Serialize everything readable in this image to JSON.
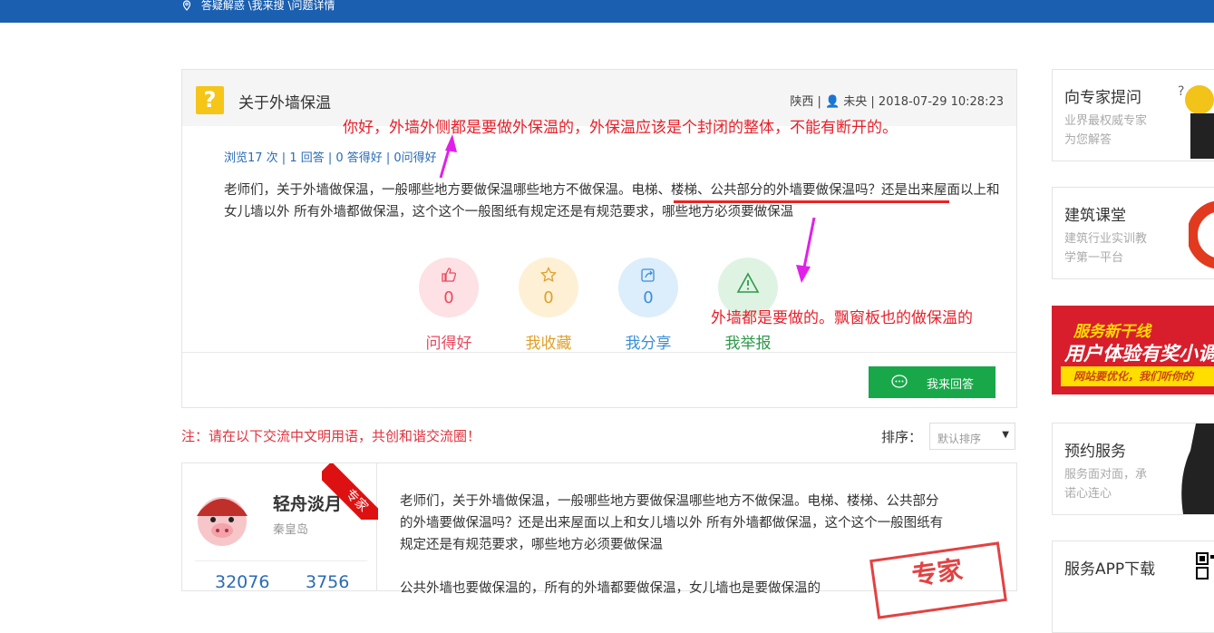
{
  "breadcrumb": "答疑解惑 \\我来搜 \\问题详情",
  "question": {
    "title": "关于外墙保温",
    "meta": "陕西 | 👤 未央 | 2018-07-29 10:28:23",
    "stats": "浏览17 次 | 1 回答 | 0 答得好 | 0问得好",
    "body": "老师们，关于外墙做保温，一般哪些地方要做保温哪些地方不做保温。电梯、楼梯、公共部分的外墙要做保温吗？还是出来屋面以上和女儿墙以外 所有外墙都做保温，这个这个一般图纸有规定还是有规范要求，哪些地方必须要做保温"
  },
  "actions": [
    {
      "label": "问得好",
      "count": "0",
      "color": "#e84a5f",
      "bg": "#fde1e4",
      "icon": "thumbs-up-icon"
    },
    {
      "label": "我收藏",
      "count": "0",
      "color": "#e0a02a",
      "bg": "#fdf0d5",
      "icon": "star-icon"
    },
    {
      "label": "我分享",
      "count": "0",
      "color": "#3a8fd8",
      "bg": "#dcedfb",
      "icon": "share-icon"
    },
    {
      "label": "我举报",
      "count": "",
      "color": "#2f9a4a",
      "bg": "#dff3e3",
      "icon": "warning-icon"
    }
  ],
  "answer_button": "我来回答",
  "note": "注：请在以下交流中文明用语，共创和谐交流圈！",
  "sort": {
    "label": "排序：",
    "selected": "默认排序"
  },
  "answer": {
    "username": "轻舟淡月",
    "city": "秦皇岛",
    "badge": "专家",
    "stat1": "32076",
    "stat2": "3756",
    "text": "老师们，关于外墙做保温，一般哪些地方要做保温哪些地方不做保温。电梯、楼梯、公共部分的外墙要做保温吗？还是出来屋面以上和女儿墙以外 所有外墙都做保温，这个这个一般图纸有规定还是有规范要求，哪些地方必须要做保温",
    "text2": "公共外墙也要做保温的，所有的外墙都要做保温，女儿墙也是要做保温的",
    "stamp": "专家"
  },
  "sidebar": [
    {
      "title": "向专家提问",
      "sub": "业界最权威专家为您解答"
    },
    {
      "title": "建筑课堂",
      "sub": "建筑行业实训教学第一平台"
    },
    {
      "title": "预约服务",
      "sub": "服务面对面，承诺心连心"
    },
    {
      "title": "服务APP下载",
      "sub": ""
    }
  ],
  "banner": {
    "line1": "服务新干线",
    "line2": "用户体验有奖小调",
    "line3": "网站要优化，我们听你的"
  },
  "annotations": {
    "a1": "你好，外墙外侧都是要做外保温的，外保温应该是个封闭的整体，不能有断开的。",
    "a2": "外墙都是要做的。飘窗板也的做保温的"
  },
  "colors": {
    "topbar": "#1a5fb0",
    "annotation": "#e8202a",
    "arrow": "#e020e8",
    "button": "#18a84a"
  }
}
